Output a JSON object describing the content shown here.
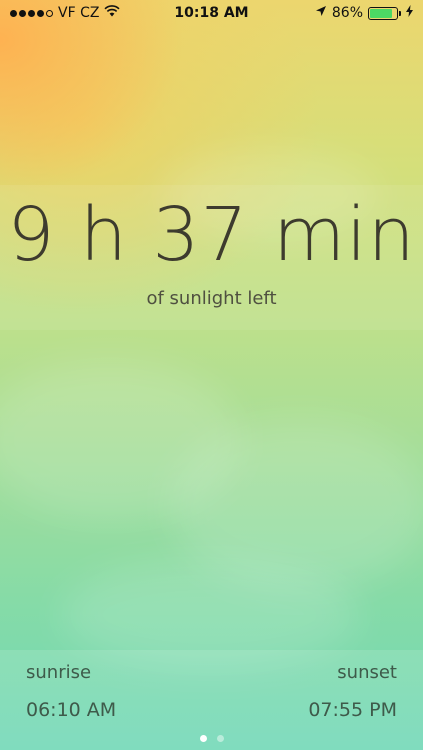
{
  "status_bar": {
    "carrier": "VF CZ",
    "time": "10:18 AM",
    "battery_percent": "86%",
    "battery_level": 0.86,
    "battery_color": "#4cd964",
    "signal_bars_filled": 4,
    "signal_bars_total": 5,
    "wifi_icon": "wifi-icon",
    "location_icon": "location-arrow-icon",
    "charging_icon": "charging-bolt-icon"
  },
  "main": {
    "value": "9 h 37 min",
    "caption": "of sunlight left"
  },
  "bottom": {
    "sunrise_label": "sunrise",
    "sunrise_time": "06:10 AM",
    "sunset_label": "sunset",
    "sunset_time": "07:55 PM"
  },
  "pager": {
    "total": 2,
    "active_index": 0
  }
}
